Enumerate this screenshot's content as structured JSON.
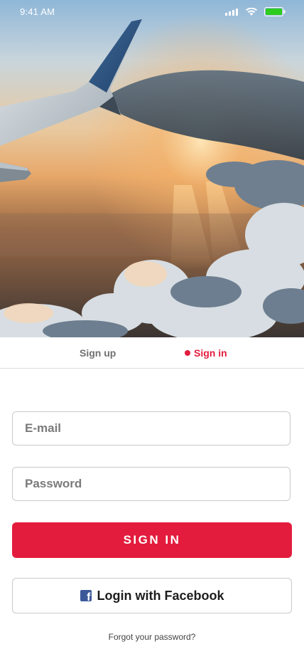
{
  "status_bar": {
    "time": "9:41 AM",
    "icons": [
      "signal-icon",
      "wifi-icon",
      "battery-icon"
    ],
    "battery_color": "#2ecc1f"
  },
  "hero": {
    "image": "airplane-wing-over-sunset-clouds"
  },
  "tabs": {
    "signup_label": "Sign up",
    "signin_label": "Sign in",
    "active": "signin"
  },
  "form": {
    "email_placeholder": "E-mail",
    "email_value": "",
    "password_placeholder": "Password",
    "password_value": "",
    "signin_label": "SIGN IN",
    "facebook_label": "Login with Facebook",
    "forgot_label": "Forgot your password?"
  },
  "colors": {
    "accent": "#e31c3d",
    "facebook": "#3b5998",
    "border": "#c9c9c9",
    "muted_text": "#707070"
  }
}
